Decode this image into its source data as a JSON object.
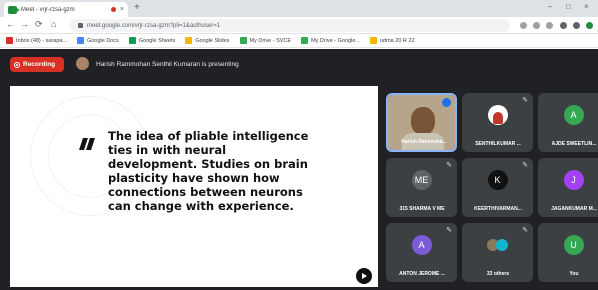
{
  "browser": {
    "tab_title": "Meet - vrjr-rzsa-gzm",
    "url": "meet.google.com/vrjr-rzsa-gzm?pli=1&authuser=1",
    "new_tab_glyph": "+",
    "close_glyph": "×",
    "window_controls": [
      "–",
      "□"
    ],
    "nav": {
      "back": "←",
      "forward": "→",
      "reload": "⟳",
      "home": "⌂"
    }
  },
  "bookmarks": [
    {
      "label": "Inbox (48) - sarapa...",
      "icon": "gmail-icon",
      "color": "#d93025"
    },
    {
      "label": "Google Docs",
      "icon": "docs-icon",
      "color": "#4285f4"
    },
    {
      "label": "Google Sheets",
      "icon": "sheets-icon",
      "color": "#0f9d58"
    },
    {
      "label": "Google Slides",
      "icon": "slides-icon",
      "color": "#f4b400"
    },
    {
      "label": "My Drive - SVCE",
      "icon": "drive-icon",
      "color": "#34a853"
    },
    {
      "label": "My Drive - Google...",
      "icon": "drive-icon",
      "color": "#34a853"
    },
    {
      "label": "udma 20 R 22",
      "icon": "folder-icon",
      "color": "#f4b400"
    }
  ],
  "meet": {
    "recording_label": "Recording",
    "presenter_text": "Harish Rammohan Senthil Kumaran is presenting",
    "slide_text": "The idea of pliable intelligence ties in with neural development. Studies on brain plasticity have shown how connections between neurons can change with experience."
  },
  "participants": [
    {
      "name": "Harish Rammoha...",
      "initial": "",
      "video": true,
      "color": "#b6a58a"
    },
    {
      "name": "SENTHILKUMAR ...",
      "initial": "",
      "video": false,
      "color": "#ffffff"
    },
    {
      "name": "AJDE SWEETLIN...",
      "initial": "A",
      "video": false,
      "color": "#34a853"
    },
    {
      "name": "315 SHARMA V ME",
      "initial": "ME",
      "video": false,
      "color": "#5f6368"
    },
    {
      "name": "KEERTHIVARMAN...",
      "initial": "K",
      "video": false,
      "color": "#111111"
    },
    {
      "name": "JAGANKUMAR M...",
      "initial": "J",
      "video": false,
      "color": "#a142f4"
    },
    {
      "name": "ANTON JEROME ...",
      "initial": "A",
      "video": false,
      "color": "#7b5bd6"
    },
    {
      "name": "33 others",
      "initial": "",
      "video": false,
      "color": "#5f6368"
    },
    {
      "name": "You",
      "initial": "U",
      "video": false,
      "color": "#34a853"
    }
  ]
}
